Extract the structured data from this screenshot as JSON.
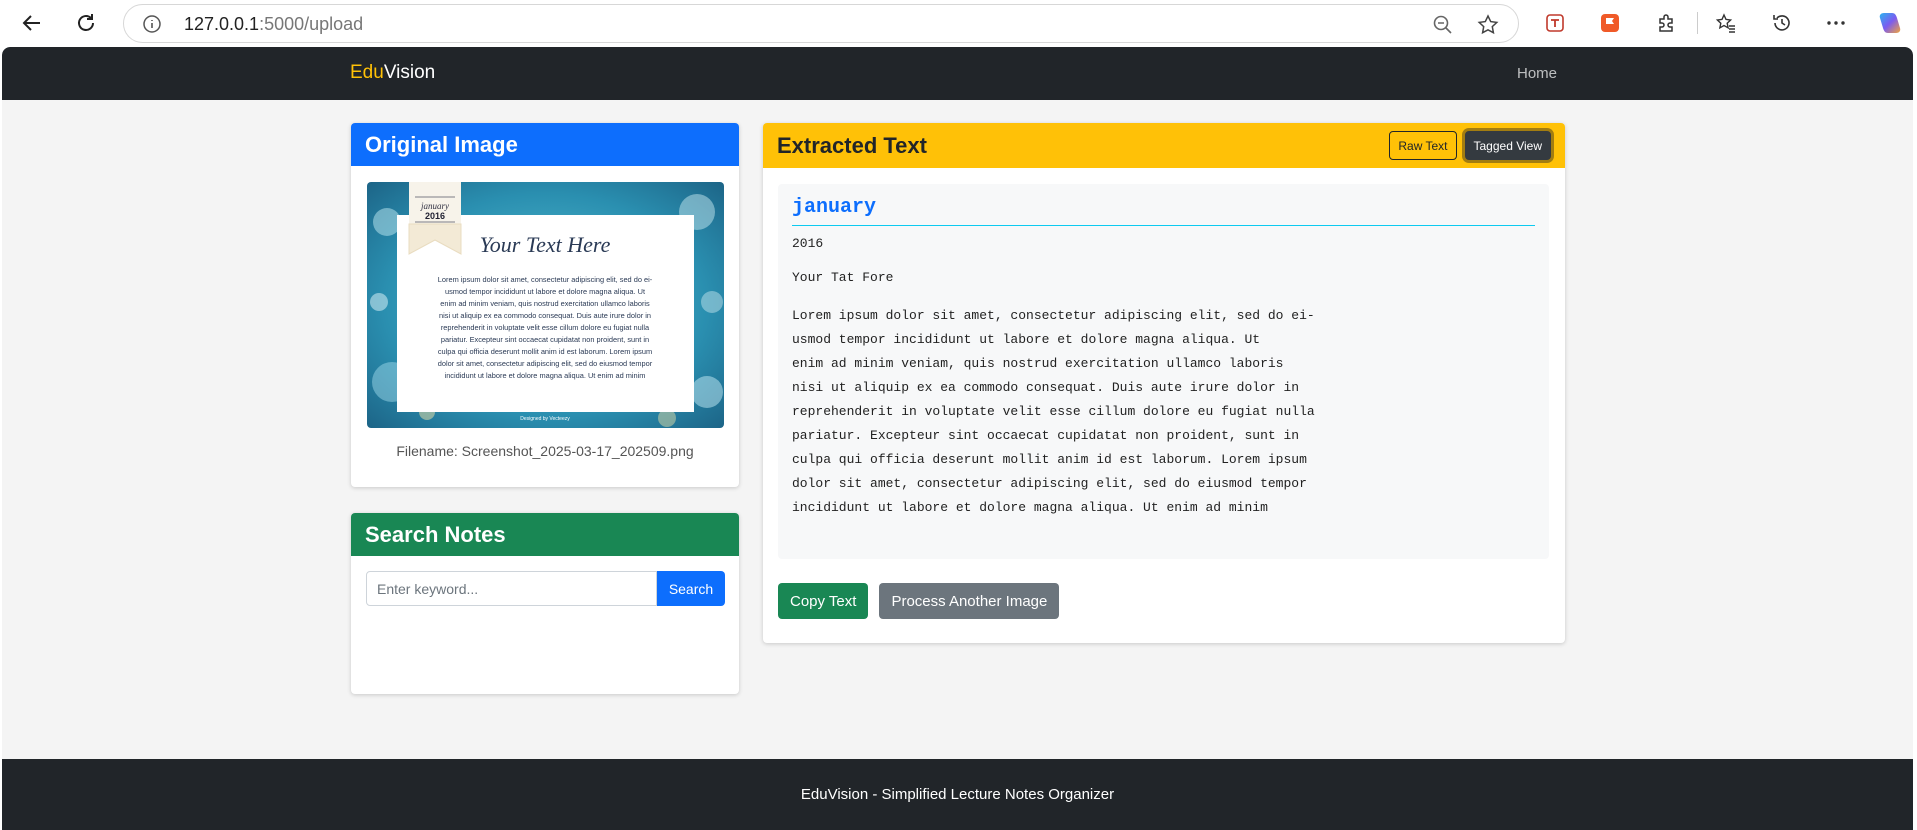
{
  "browser": {
    "url_host": "127.0.0.1",
    "url_path": ":5000/upload"
  },
  "nav": {
    "brand_prefix": "Edu",
    "brand_suffix": "Vision",
    "home_link": "Home"
  },
  "original_card": {
    "title": "Original Image",
    "filename": "Filename: Screenshot_2025-03-17_202509.png",
    "image": {
      "month": "january",
      "year": "2016",
      "heading": "Your Text Here",
      "body": "Lorem ipsum dolor sit amet, consectetur adipiscing elit, sed do ei-usmod tempor incididunt ut labore et dolore magna aliqua. Ut enim ad minim veniam, quis nostrud exercitation ullamco laboris nisi ut aliquip ex ea commodo consequat. Duis aute irure dolor in reprehenderit in voluptate velit esse cillum dolore eu fugiat nulla pariatur. Excepteur sint occaecat cupidatat non proident, sunt in culpa qui officia deserunt mollit anim id est laborum. Lorem ipsum dolor sit amet, consectetur adipiscing elit, sed do eiusmod tempor incididunt ut labore et dolore magna aliqua. Ut enim ad minim",
      "credit": "Designed by Vecteezy"
    }
  },
  "search_card": {
    "title": "Search Notes",
    "placeholder": "Enter keyword...",
    "button": "Search"
  },
  "extracted_card": {
    "title": "Extracted Text",
    "raw_button": "Raw Text",
    "tagged_button": "Tagged View",
    "tag_title": "january",
    "year": "2016",
    "line2": "Your Tat Fore",
    "paragraph": "Lorem ipsum dolor sit amet, consectetur adipiscing elit, sed do ei-\nusmod tempor incididunt ut labore et dolore magna aliqua. Ut\nenim ad minim veniam, quis nostrud exercitation ullamco laboris\nnisi ut aliquip ex ea commodo consequat. Duis aute irure dolor in\nreprehenderit in voluptate velit esse cillum dolore eu fugiat nulla\npariatur. Excepteur sint occaecat cupidatat non proident, sunt in\nculpa qui officia deserunt mollit anim id est laborum. Lorem ipsum\ndolor sit amet, consectetur adipiscing elit, sed do eiusmod tempor\nincididunt ut labore et dolore magna aliqua. Ut enim ad minim",
    "copy_button": "Copy Text",
    "process_button": "Process Another Image"
  },
  "footer": {
    "text": "EduVision - Simplified Lecture Notes Organizer"
  },
  "colors": {
    "primary": "#0d6efd",
    "success": "#198754",
    "warning": "#ffc107",
    "dark": "#212529",
    "secondary": "#6c757d"
  }
}
